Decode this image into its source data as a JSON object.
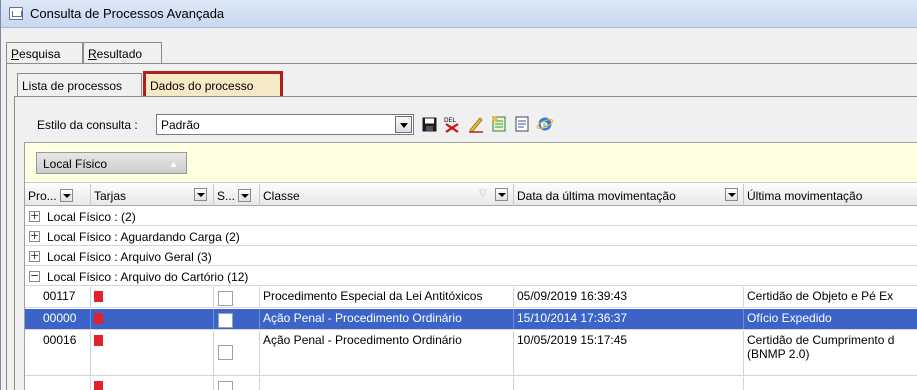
{
  "window": {
    "title": "Consulta de Processos Avançada"
  },
  "outer_tabs": [
    {
      "label": "Pesquisa",
      "accel": "P"
    },
    {
      "label": "Resultado",
      "accel": "R"
    }
  ],
  "inner_tabs": [
    {
      "label": "Lista de processos"
    },
    {
      "label": "Dados do processo"
    }
  ],
  "toolbar": {
    "estilo_label": "Estilo da consulta :",
    "estilo_value": "Padrão",
    "icons": [
      "save-icon",
      "delete-icon",
      "edit-icon",
      "export-icon",
      "report-icon",
      "browser-icon"
    ]
  },
  "grid": {
    "group_chip": "Local Físico",
    "columns": [
      {
        "label": "Pro..."
      },
      {
        "label": "Tarjas"
      },
      {
        "label": "S..."
      },
      {
        "label": "Classe"
      },
      {
        "label": "Data da última movimentação"
      },
      {
        "label": "Última movimentação"
      }
    ],
    "groups": [
      {
        "expander": "+",
        "label": "Local Físico :  (2)"
      },
      {
        "expander": "+",
        "label": "Local Físico : Aguardando Carga (2)"
      },
      {
        "expander": "+",
        "label": "Local Físico : Arquivo Geral (3)"
      },
      {
        "expander": "−",
        "label": "Local Físico : Arquivo do Cartório (12)"
      }
    ],
    "rows": [
      {
        "pro": "00117",
        "classe": "Procedimento Especial da Lei Antitóxicos",
        "data": "05/09/2019 16:39:43",
        "ultima": "Certidão de Objeto e Pé Ex"
      },
      {
        "pro": "00000",
        "classe": "Ação Penal - Procedimento Ordinário",
        "data": "15/10/2014 17:36:37",
        "ultima": "Ofício Expedido"
      },
      {
        "pro": "00016",
        "classe": "Ação Penal - Procedimento Ordinário",
        "data": "10/05/2019 15:17:45",
        "ultima": "Certidão de Cumprimento d (BNMP 2.0)"
      }
    ]
  },
  "colors": {
    "selection": "#3c64c8",
    "tarja_red": "#e0222a",
    "highlight_border": "#b01f1f",
    "group_bar": "#ffffe1"
  }
}
